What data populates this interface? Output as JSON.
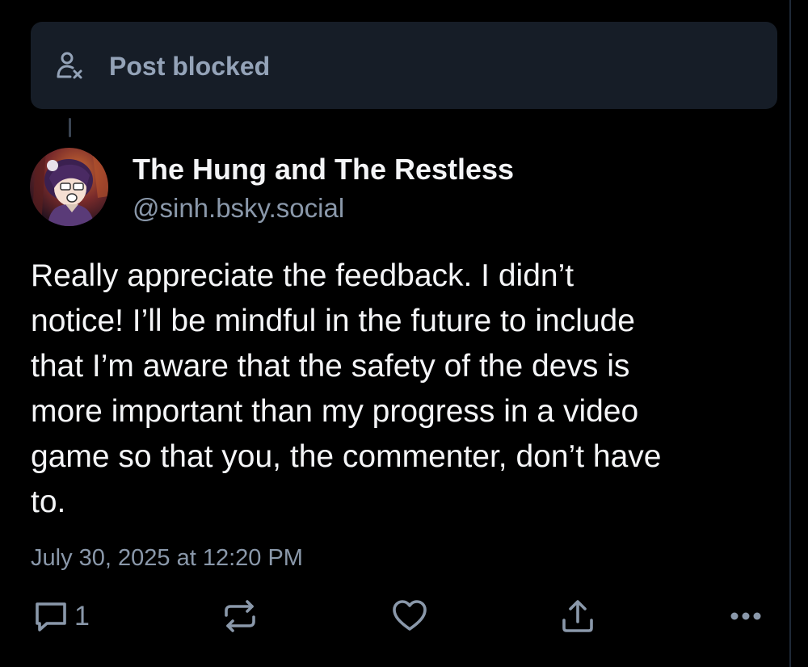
{
  "blocked_notice": {
    "icon": "user-blocked-icon",
    "label": "Post blocked"
  },
  "post": {
    "author": {
      "display_name": "The Hung and The Restless",
      "handle": "@sinh.bsky.social",
      "avatar": "anime-character-avatar"
    },
    "text_lines": [
      "Really appreciate the feedback. I didn’t",
      "notice! I’ll be mindful in the future to include",
      "that I’m aware that the safety of the devs is",
      "more important than my progress in a video",
      "game so that you, the commenter, don’t have",
      "to."
    ],
    "timestamp": "July 30, 2025 at 12:20 PM"
  },
  "actions": {
    "reply": {
      "icon": "reply-icon",
      "count": "1"
    },
    "repost": {
      "icon": "repost-icon"
    },
    "like": {
      "icon": "heart-icon"
    },
    "share": {
      "icon": "share-icon"
    },
    "more": {
      "icon": "more-options-icon"
    }
  },
  "colors": {
    "background": "#000000",
    "card": "#161d27",
    "muted_text": "#8a98aa",
    "primary_text": "#f4f5f7"
  }
}
